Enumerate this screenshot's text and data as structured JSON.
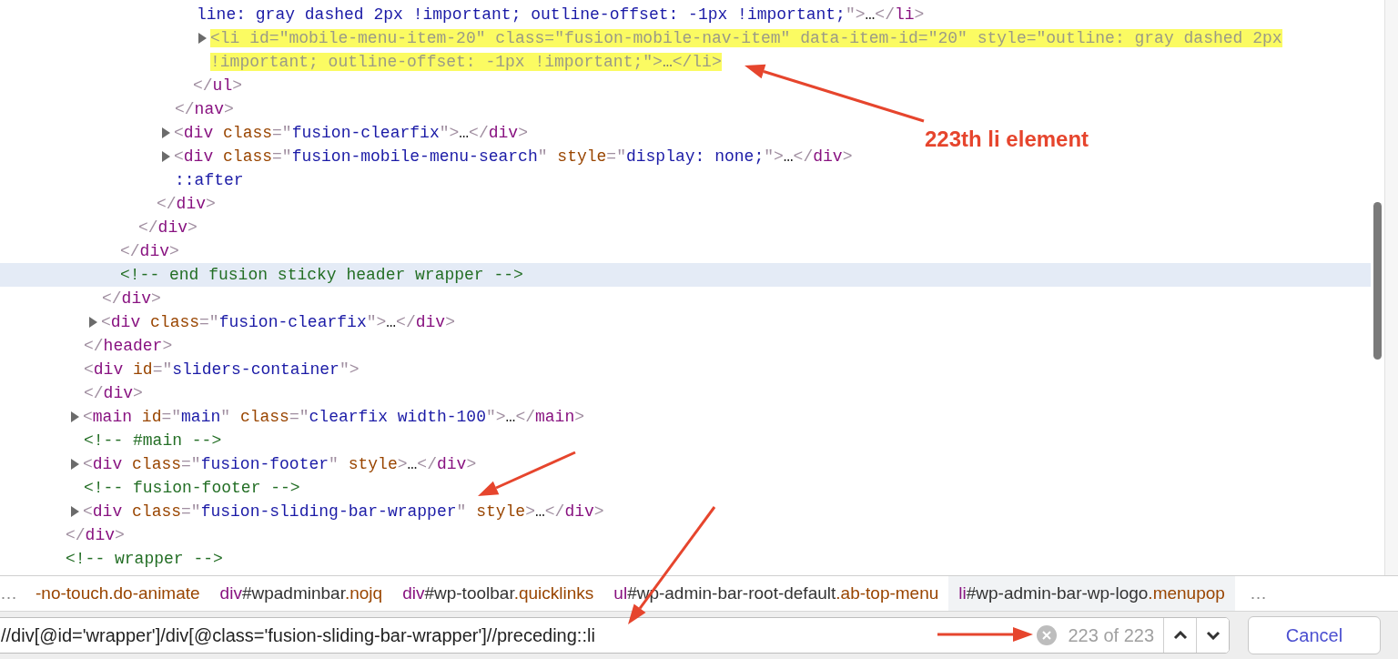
{
  "tree": [
    {
      "children": [
        {
          "children": [
            {
              "children": [
                {
                  "children": [
                    {
                      "children": [
                        {
                          "children": [
                            {
                              "children": [
                                {
                                  "children": [
                                    {
                                      "kind": "continuation",
                                      "open": [
                                        {
                                          "kind": "value",
                                          "text": "line: gray dashed 2px !important; outline-offset: -1px !important;"
                                        },
                                        {
                                          "kind": "punct",
                                          "text": "\">"
                                        },
                                        {
                                          "kind": "ellipsis",
                                          "text": "…"
                                        },
                                        {
                                          "kind": "punct",
                                          "text": "</"
                                        },
                                        {
                                          "kind": "tag",
                                          "text": "li"
                                        },
                                        {
                                          "kind": "punct",
                                          "text": ">"
                                        }
                                      ]
                                    },
                                    {
                                      "kind": "node",
                                      "expandable": true,
                                      "highlighted": true,
                                      "selected": false,
                                      "open": [
                                        {
                                          "kind": "punct",
                                          "text": "<"
                                        },
                                        {
                                          "kind": "tag",
                                          "text": "li"
                                        },
                                        {
                                          "kind": "attr",
                                          "text": "id"
                                        },
                                        {
                                          "kind": "punct",
                                          "text": "=\""
                                        },
                                        {
                                          "kind": "value",
                                          "text": "mobile-menu-item-20"
                                        },
                                        {
                                          "kind": "punct",
                                          "text": "\""
                                        },
                                        {
                                          "kind": "attr",
                                          "text": "class"
                                        },
                                        {
                                          "kind": "punct",
                                          "text": "=\""
                                        },
                                        {
                                          "kind": "value",
                                          "text": "fusion-mobile-nav-item"
                                        },
                                        {
                                          "kind": "punct",
                                          "text": "\""
                                        },
                                        {
                                          "kind": "attr",
                                          "text": "data-item-id"
                                        },
                                        {
                                          "kind": "punct",
                                          "text": "=\""
                                        },
                                        {
                                          "kind": "value",
                                          "text": "20"
                                        },
                                        {
                                          "kind": "punct",
                                          "text": "\""
                                        },
                                        {
                                          "kind": "attr",
                                          "text": "style"
                                        },
                                        {
                                          "kind": "punct",
                                          "text": "=\""
                                        },
                                        {
                                          "kind": "value",
                                          "text": "outline: gray dashed 2px !important; outline-offset: -1px !important;"
                                        },
                                        {
                                          "kind": "punct",
                                          "text": "\">"
                                        },
                                        {
                                          "kind": "ellipsis",
                                          "text": "…"
                                        },
                                        {
                                          "kind": "punct",
                                          "text": "</"
                                        },
                                        {
                                          "kind": "tag",
                                          "text": "li"
                                        },
                                        {
                                          "kind": "punct",
                                          "text": ">"
                                        }
                                      ]
                                    }
                                  ],
                                  "close": [
                                    {
                                      "kind": "punct",
                                      "text": "</"
                                    },
                                    {
                                      "kind": "tag",
                                      "text": "ul"
                                    },
                                    {
                                      "kind": "punct",
                                      "text": ">"
                                    }
                                  ]
                                }
                              ],
                              "close": [
                                {
                                  "kind": "punct",
                                  "text": "</"
                                },
                                {
                                  "kind": "tag",
                                  "text": "nav"
                                },
                                {
                                  "kind": "punct",
                                  "text": ">"
                                }
                              ]
                            },
                            {
                              "kind": "node",
                              "expandable": true,
                              "selected": false,
                              "open": [
                                {
                                  "kind": "punct",
                                  "text": "<"
                                },
                                {
                                  "kind": "tag",
                                  "text": "div"
                                },
                                {
                                  "kind": "attr",
                                  "text": "class"
                                },
                                {
                                  "kind": "punct",
                                  "text": "=\""
                                },
                                {
                                  "kind": "value",
                                  "text": "fusion-clearfix"
                                },
                                {
                                  "kind": "punct",
                                  "text": "\">"
                                },
                                {
                                  "kind": "ellipsis",
                                  "text": "…"
                                },
                                {
                                  "kind": "punct",
                                  "text": "</"
                                },
                                {
                                  "kind": "tag",
                                  "text": "div"
                                },
                                {
                                  "kind": "punct",
                                  "text": ">"
                                }
                              ]
                            },
                            {
                              "kind": "node",
                              "expandable": true,
                              "selected": false,
                              "open": [
                                {
                                  "kind": "punct",
                                  "text": "<"
                                },
                                {
                                  "kind": "tag",
                                  "text": "div"
                                },
                                {
                                  "kind": "attr",
                                  "text": "class"
                                },
                                {
                                  "kind": "punct",
                                  "text": "=\""
                                },
                                {
                                  "kind": "value",
                                  "text": "fusion-mobile-menu-search"
                                },
                                {
                                  "kind": "punct",
                                  "text": "\""
                                },
                                {
                                  "kind": "attr",
                                  "text": "style"
                                },
                                {
                                  "kind": "punct",
                                  "text": "=\""
                                },
                                {
                                  "kind": "value",
                                  "text": "display: none;"
                                },
                                {
                                  "kind": "punct",
                                  "text": "\">"
                                },
                                {
                                  "kind": "ellipsis",
                                  "text": "…"
                                },
                                {
                                  "kind": "punct",
                                  "text": "</"
                                },
                                {
                                  "kind": "tag",
                                  "text": "div"
                                },
                                {
                                  "kind": "punct",
                                  "text": ">"
                                }
                              ]
                            },
                            {
                              "kind": "node",
                              "selected": false,
                              "open": [
                                {
                                  "kind": "pseudo",
                                  "text": "::after"
                                }
                              ]
                            }
                          ],
                          "close": [
                            {
                              "kind": "punct",
                              "text": "</"
                            },
                            {
                              "kind": "tag",
                              "text": "div"
                            },
                            {
                              "kind": "punct",
                              "text": ">"
                            }
                          ]
                        }
                      ],
                      "close": [
                        {
                          "kind": "punct",
                          "text": "</"
                        },
                        {
                          "kind": "tag",
                          "text": "div"
                        },
                        {
                          "kind": "punct",
                          "text": ">"
                        }
                      ]
                    }
                  ],
                  "close": [
                    {
                      "kind": "punct",
                      "text": "</"
                    },
                    {
                      "kind": "tag",
                      "text": "div"
                    },
                    {
                      "kind": "punct",
                      "text": ">"
                    }
                  ]
                },
                {
                  "kind": "node",
                  "selected": true,
                  "open": [
                    {
                      "kind": "comment",
                      "text": "<!-- end fusion sticky header wrapper -->"
                    }
                  ]
                }
              ],
              "close": [
                {
                  "kind": "punct",
                  "text": "</"
                },
                {
                  "kind": "tag",
                  "text": "div"
                },
                {
                  "kind": "punct",
                  "text": ">"
                }
              ]
            },
            {
              "kind": "node",
              "expandable": true,
              "selected": false,
              "open": [
                {
                  "kind": "punct",
                  "text": "<"
                },
                {
                  "kind": "tag",
                  "text": "div"
                },
                {
                  "kind": "attr",
                  "text": "class"
                },
                {
                  "kind": "punct",
                  "text": "=\""
                },
                {
                  "kind": "value",
                  "text": "fusion-clearfix"
                },
                {
                  "kind": "punct",
                  "text": "\">"
                },
                {
                  "kind": "ellipsis",
                  "text": "…"
                },
                {
                  "kind": "punct",
                  "text": "</"
                },
                {
                  "kind": "tag",
                  "text": "div"
                },
                {
                  "kind": "punct",
                  "text": ">"
                }
              ]
            }
          ],
          "close": [
            {
              "kind": "punct",
              "text": "</"
            },
            {
              "kind": "tag",
              "text": "header"
            },
            {
              "kind": "punct",
              "text": ">"
            }
          ]
        },
        {
          "kind": "node",
          "selected": false,
          "open": [
            {
              "kind": "punct",
              "text": "<"
            },
            {
              "kind": "tag",
              "text": "div"
            },
            {
              "kind": "attr",
              "text": "id"
            },
            {
              "kind": "punct",
              "text": "=\""
            },
            {
              "kind": "value",
              "text": "sliders-container"
            },
            {
              "kind": "punct",
              "text": "\">"
            }
          ],
          "close": [
            {
              "kind": "punct",
              "text": "</"
            },
            {
              "kind": "tag",
              "text": "div"
            },
            {
              "kind": "punct",
              "text": ">"
            }
          ]
        },
        {
          "kind": "node",
          "expandable": true,
          "selected": false,
          "open": [
            {
              "kind": "punct",
              "text": "<"
            },
            {
              "kind": "tag",
              "text": "main"
            },
            {
              "kind": "attr",
              "text": "id"
            },
            {
              "kind": "punct",
              "text": "=\""
            },
            {
              "kind": "value",
              "text": "main"
            },
            {
              "kind": "punct",
              "text": "\""
            },
            {
              "kind": "attr",
              "text": "class"
            },
            {
              "kind": "punct",
              "text": "=\""
            },
            {
              "kind": "value",
              "text": "clearfix width-100"
            },
            {
              "kind": "punct",
              "text": "\">"
            },
            {
              "kind": "ellipsis",
              "text": "…"
            },
            {
              "kind": "punct",
              "text": "</"
            },
            {
              "kind": "tag",
              "text": "main"
            },
            {
              "kind": "punct",
              "text": ">"
            }
          ]
        },
        {
          "kind": "node",
          "selected": false,
          "open": [
            {
              "kind": "comment",
              "text": "<!-- #main -->"
            }
          ]
        },
        {
          "kind": "node",
          "expandable": true,
          "selected": false,
          "open": [
            {
              "kind": "punct",
              "text": "<"
            },
            {
              "kind": "tag",
              "text": "div"
            },
            {
              "kind": "attr",
              "text": "class"
            },
            {
              "kind": "punct",
              "text": "=\""
            },
            {
              "kind": "value",
              "text": "fusion-footer"
            },
            {
              "kind": "punct",
              "text": "\""
            },
            {
              "kind": "attr",
              "text": "style"
            },
            {
              "kind": "punct",
              "text": ">"
            },
            {
              "kind": "ellipsis",
              "text": "…"
            },
            {
              "kind": "punct",
              "text": "</"
            },
            {
              "kind": "tag",
              "text": "div"
            },
            {
              "kind": "punct",
              "text": ">"
            }
          ]
        },
        {
          "kind": "node",
          "selected": false,
          "open": [
            {
              "kind": "comment",
              "text": "<!-- fusion-footer -->"
            }
          ]
        },
        {
          "kind": "node",
          "expandable": true,
          "selected": false,
          "open": [
            {
              "kind": "punct",
              "text": "<"
            },
            {
              "kind": "tag",
              "text": "div"
            },
            {
              "kind": "attr",
              "text": "class"
            },
            {
              "kind": "punct",
              "text": "=\""
            },
            {
              "kind": "value",
              "text": "fusion-sliding-bar-wrapper"
            },
            {
              "kind": "punct",
              "text": "\""
            },
            {
              "kind": "attr",
              "text": "style"
            },
            {
              "kind": "punct",
              "text": ">"
            },
            {
              "kind": "ellipsis",
              "text": "…"
            },
            {
              "kind": "punct",
              "text": "</"
            },
            {
              "kind": "tag",
              "text": "div"
            },
            {
              "kind": "punct",
              "text": ">"
            }
          ]
        }
      ],
      "close": [
        {
          "kind": "punct",
          "text": "</"
        },
        {
          "kind": "tag",
          "text": "div"
        },
        {
          "kind": "punct",
          "text": ">"
        }
      ]
    },
    {
      "kind": "node",
      "selected": false,
      "open": [
        {
          "kind": "comment",
          "text": "<!-- wrapper -->"
        }
      ]
    }
  ],
  "annotation": {
    "label": "223th li element"
  },
  "breadcrumbs": {
    "overflow_left": "…",
    "overflow_right": "…",
    "items": [
      {
        "selected": false,
        "parts": [
          {
            "kind": "class",
            "text": "-no-touch.do-animate"
          }
        ]
      },
      {
        "selected": false,
        "parts": [
          {
            "kind": "tag",
            "text": "div"
          },
          {
            "kind": "id",
            "text": "#wpadminbar"
          },
          {
            "kind": "class",
            "text": ".nojq"
          }
        ]
      },
      {
        "selected": false,
        "parts": [
          {
            "kind": "tag",
            "text": "div"
          },
          {
            "kind": "id",
            "text": "#wp-toolbar"
          },
          {
            "kind": "class",
            "text": ".quicklinks"
          }
        ]
      },
      {
        "selected": false,
        "parts": [
          {
            "kind": "tag",
            "text": "ul"
          },
          {
            "kind": "id",
            "text": "#wp-admin-bar-root-default"
          },
          {
            "kind": "class",
            "text": ".ab-top-menu"
          }
        ]
      },
      {
        "selected": true,
        "parts": [
          {
            "kind": "tag",
            "text": "li"
          },
          {
            "kind": "id",
            "text": "#wp-admin-bar-wp-logo"
          },
          {
            "kind": "class",
            "text": ".menupop"
          }
        ]
      }
    ]
  },
  "search": {
    "query": "//div[@id='wrapper']/div[@class='fusion-sliding-bar-wrapper']//preceding::li",
    "matches": "223 of 223",
    "cancel": "Cancel"
  }
}
